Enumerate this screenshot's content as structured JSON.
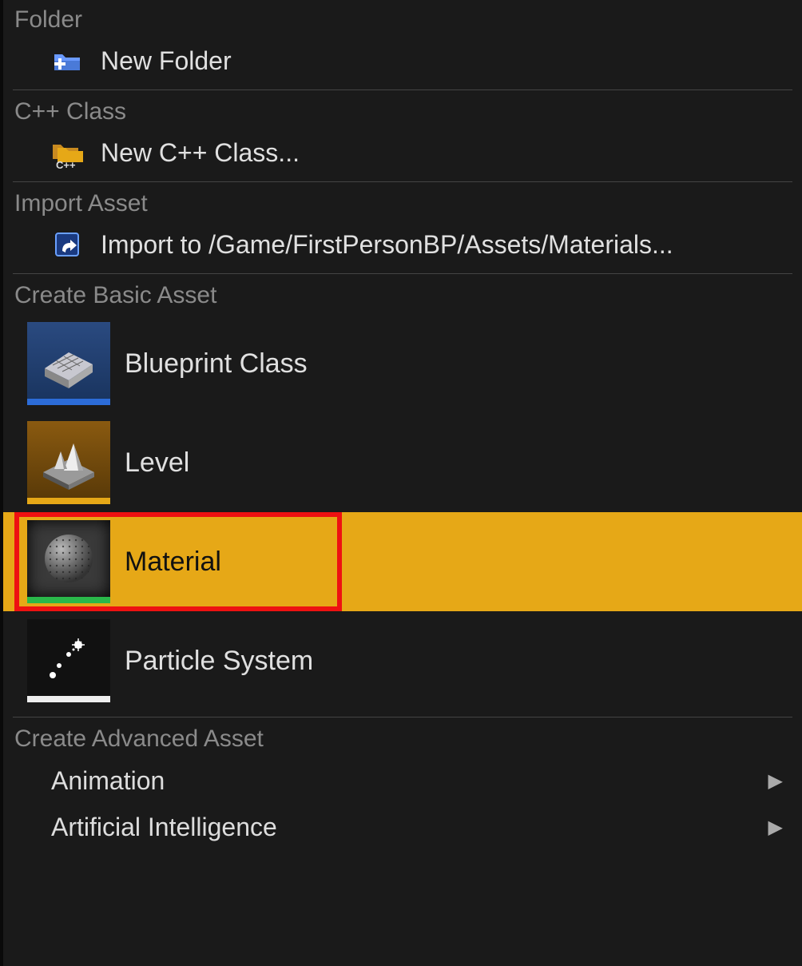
{
  "sections": {
    "folder": {
      "header": "Folder",
      "new_folder_label": "New Folder"
    },
    "cpp": {
      "header": "C++ Class",
      "new_class_label": "New C++ Class..."
    },
    "import": {
      "header": "Import Asset",
      "import_label": "Import to /Game/FirstPersonBP/Assets/Materials..."
    },
    "basic": {
      "header": "Create Basic Asset",
      "items": [
        {
          "label": "Blueprint Class",
          "icon": "blueprint-icon"
        },
        {
          "label": "Level",
          "icon": "level-icon"
        },
        {
          "label": "Material",
          "icon": "material-icon",
          "highlighted": true
        },
        {
          "label": "Particle System",
          "icon": "particle-icon"
        }
      ]
    },
    "advanced": {
      "header": "Create Advanced Asset",
      "items": [
        {
          "label": "Animation"
        },
        {
          "label": "Artificial Intelligence"
        }
      ]
    }
  },
  "colors": {
    "highlight": "#e6a817",
    "outline": "#e11"
  }
}
